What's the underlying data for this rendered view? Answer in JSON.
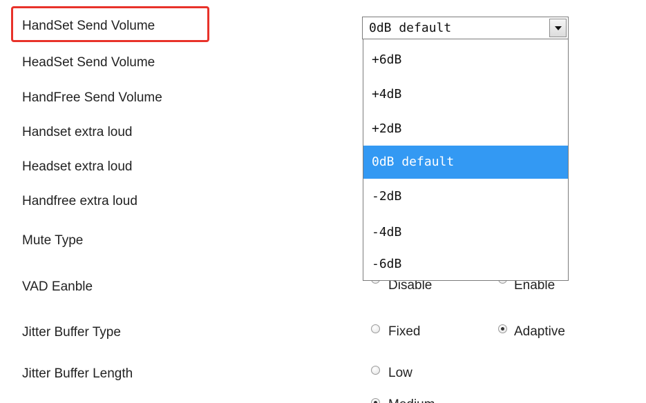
{
  "settings": {
    "rows": [
      {
        "label": "HandSet Send Volume"
      },
      {
        "label": "HeadSet Send Volume"
      },
      {
        "label": "HandFree Send Volume"
      },
      {
        "label": "Handset extra loud"
      },
      {
        "label": "Headset extra loud"
      },
      {
        "label": "Handfree extra loud"
      },
      {
        "label": "Mute Type"
      },
      {
        "label": "VAD Eanble"
      },
      {
        "label": "Jitter Buffer Type"
      },
      {
        "label": "Jitter Buffer Length"
      }
    ]
  },
  "volume_select": {
    "value": "0dB default",
    "options": [
      "+6dB",
      "+4dB",
      "+2dB",
      "0dB default",
      "-2dB",
      "-4dB",
      "-6dB"
    ],
    "selected_index": 3
  },
  "vad": {
    "options": [
      "Disable",
      "Enable"
    ],
    "selected": "Disable"
  },
  "jitter_type": {
    "options": [
      "Fixed",
      "Adaptive"
    ],
    "selected": "Adaptive"
  },
  "jitter_length": {
    "options": [
      "Low",
      "Medium"
    ],
    "selected": "Medium"
  },
  "colors": {
    "highlight": "#e8322a",
    "selected_option": "#3399f3"
  }
}
